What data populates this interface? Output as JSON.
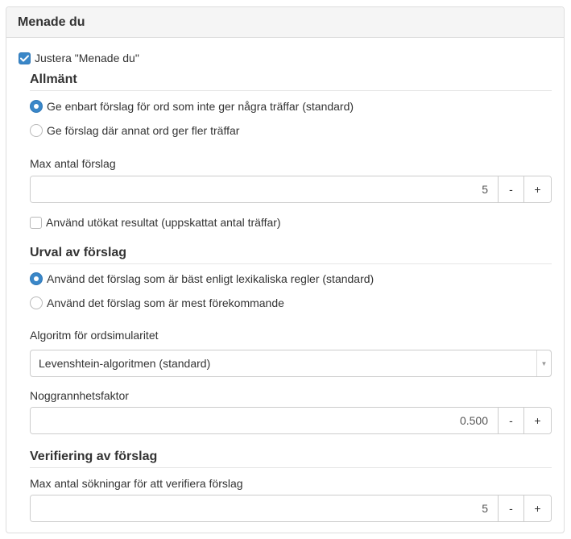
{
  "panel": {
    "title": "Menade du"
  },
  "main_toggle": {
    "label": "Justera \"Menade du\"",
    "checked": true
  },
  "general": {
    "title": "Allmänt",
    "radios": [
      {
        "label": "Ge enbart förslag för ord som inte ger några träffar (standard)",
        "checked": true
      },
      {
        "label": "Ge förslag där annat ord ger fler träffar",
        "checked": false
      }
    ],
    "max_suggestions": {
      "label": "Max antal förslag",
      "value": "5",
      "minus": "-",
      "plus": "+"
    },
    "extended_result": {
      "label": "Använd utökat resultat (uppskattat antal träffar)",
      "checked": false
    }
  },
  "selection": {
    "title": "Urval av förslag",
    "radios": [
      {
        "label": "Använd det förslag som är bäst enligt lexikaliska regler (standard)",
        "checked": true
      },
      {
        "label": "Använd det förslag som är mest förekommande",
        "checked": false
      }
    ],
    "algorithm": {
      "label": "Algoritm för ordsimularitet",
      "selected": "Levenshtein-algoritmen (standard)"
    },
    "accuracy": {
      "label": "Noggrannhetsfaktor",
      "value": "0.500",
      "minus": "-",
      "plus": "+"
    }
  },
  "verification": {
    "title": "Verifiering av förslag",
    "max_searches": {
      "label": "Max antal sökningar för att verifiera förslag",
      "value": "5",
      "minus": "-",
      "plus": "+"
    }
  },
  "colors": {
    "accent": "#3a87c8",
    "border": "#cccccc",
    "heading_bg": "#f5f5f5"
  }
}
